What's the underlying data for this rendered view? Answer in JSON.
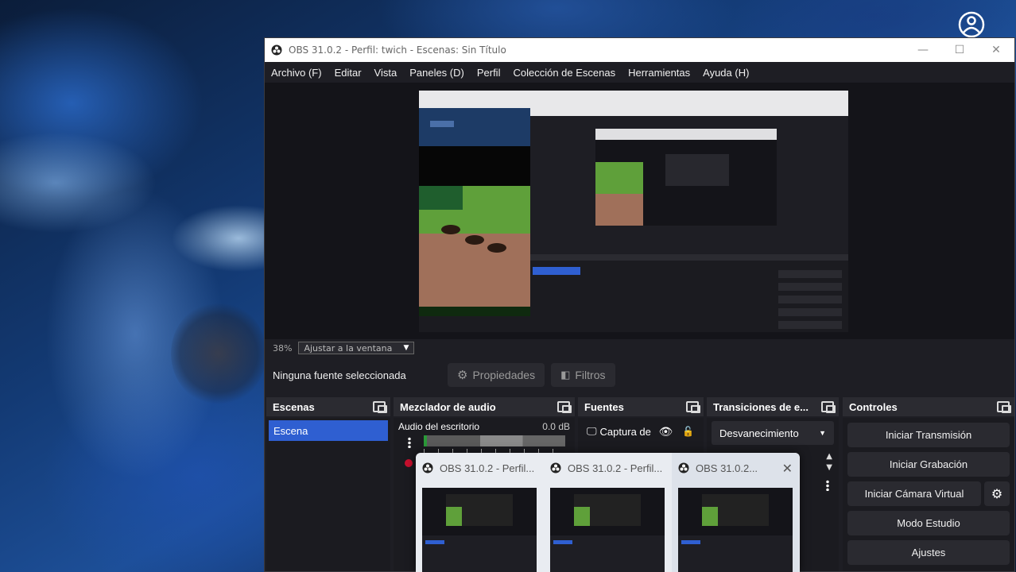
{
  "window": {
    "title": "OBS 31.0.2 - Perfil: twich - Escenas: Sin Título"
  },
  "menu": [
    "Archivo (F)",
    "Editar",
    "Vista",
    "Paneles (D)",
    "Perfil",
    "Colección de Escenas",
    "Herramientas",
    "Ayuda (H)"
  ],
  "preview": {
    "zoom": "38%",
    "zoom_mode": "Ajustar a la ventana"
  },
  "source_bar": {
    "no_source": "Ninguna fuente seleccionada",
    "properties": "Propiedades",
    "filters": "Filtros"
  },
  "docks": {
    "scenes": {
      "title": "Escenas",
      "items": [
        "Escena"
      ]
    },
    "mixer": {
      "title": "Mezclador de audio",
      "channel": "Audio del escritorio",
      "db": "0.0 dB"
    },
    "sources": {
      "title": "Fuentes",
      "items": [
        "Captura de"
      ]
    },
    "transitions": {
      "title": "Transiciones de e...",
      "selected": "Desvanecimiento"
    },
    "controls": {
      "title": "Controles",
      "start_stream": "Iniciar Transmisión",
      "start_record": "Iniciar Grabación",
      "start_vcam": "Iniciar Cámara Virtual",
      "studio_mode": "Modo Estudio",
      "settings": "Ajustes"
    }
  },
  "taskbar_preview": {
    "items": [
      "OBS 31.0.2 - Perfil...",
      "OBS 31.0.2 - Perfil...",
      "OBS 31.0.2..."
    ]
  }
}
